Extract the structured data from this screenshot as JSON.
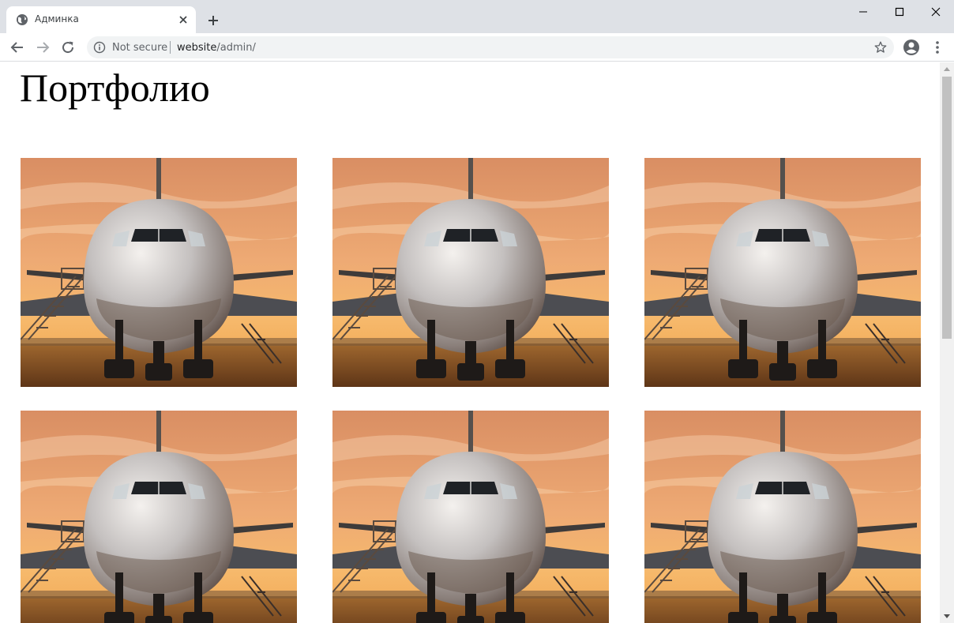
{
  "browser": {
    "tab_title": "Админка",
    "security_label": "Not secure",
    "url_host": "website",
    "url_path": "/admin/"
  },
  "page": {
    "title": "Портфолио"
  },
  "gallery": {
    "items": [
      {
        "alt": "airplane"
      },
      {
        "alt": "airplane"
      },
      {
        "alt": "airplane"
      },
      {
        "alt": "airplane"
      },
      {
        "alt": "airplane"
      },
      {
        "alt": "airplane"
      }
    ]
  },
  "icons": [
    "globe-icon",
    "close-icon",
    "plus-icon",
    "minimize-icon",
    "maximize-icon",
    "window-close-icon",
    "back-arrow-icon",
    "forward-arrow-icon",
    "reload-icon",
    "info-icon",
    "star-icon",
    "account-icon",
    "kebab-menu-icon"
  ],
  "colors": {
    "tabstrip": "#dee1e6",
    "omnibox": "#f1f3f4",
    "sky_top": "#e8a06a",
    "sky_bottom": "#f2b26e"
  }
}
